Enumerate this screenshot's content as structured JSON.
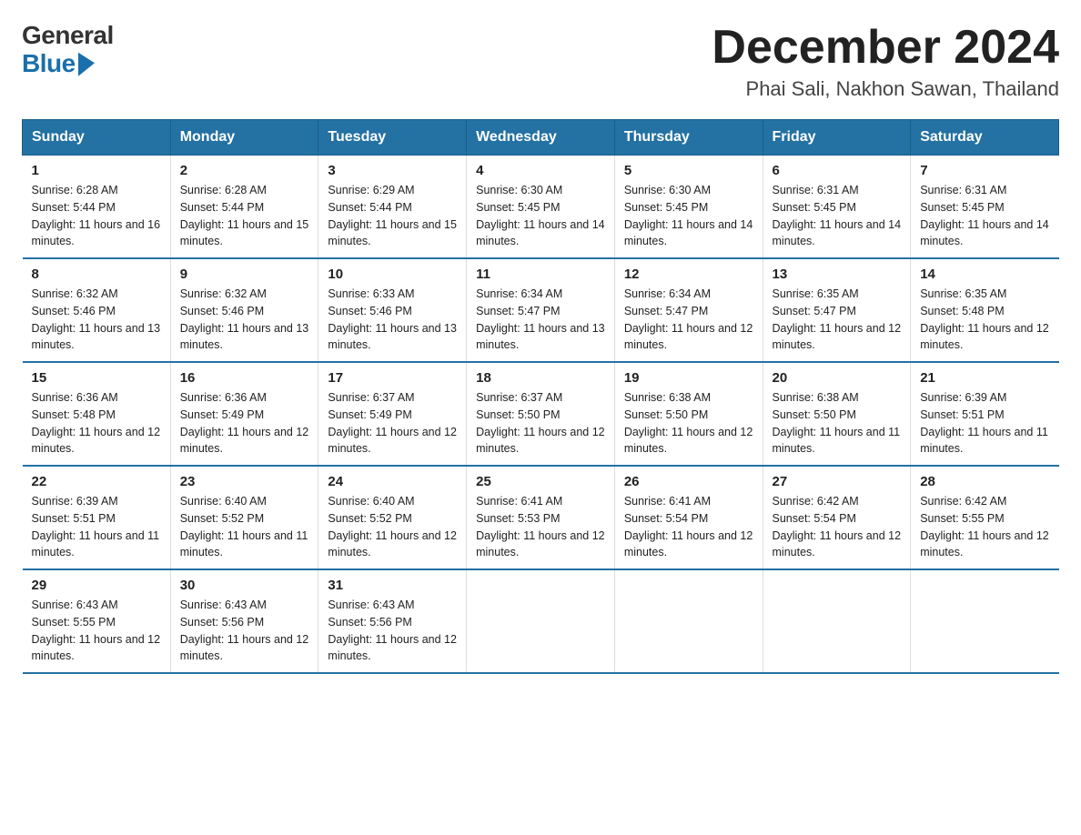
{
  "header": {
    "logo_general": "General",
    "logo_blue": "Blue",
    "month_title": "December 2024",
    "location": "Phai Sali, Nakhon Sawan, Thailand"
  },
  "weekdays": [
    "Sunday",
    "Monday",
    "Tuesday",
    "Wednesday",
    "Thursday",
    "Friday",
    "Saturday"
  ],
  "weeks": [
    [
      {
        "day": "1",
        "sunrise": "6:28 AM",
        "sunset": "5:44 PM",
        "daylight": "11 hours and 16 minutes."
      },
      {
        "day": "2",
        "sunrise": "6:28 AM",
        "sunset": "5:44 PM",
        "daylight": "11 hours and 15 minutes."
      },
      {
        "day": "3",
        "sunrise": "6:29 AM",
        "sunset": "5:44 PM",
        "daylight": "11 hours and 15 minutes."
      },
      {
        "day": "4",
        "sunrise": "6:30 AM",
        "sunset": "5:45 PM",
        "daylight": "11 hours and 14 minutes."
      },
      {
        "day": "5",
        "sunrise": "6:30 AM",
        "sunset": "5:45 PM",
        "daylight": "11 hours and 14 minutes."
      },
      {
        "day": "6",
        "sunrise": "6:31 AM",
        "sunset": "5:45 PM",
        "daylight": "11 hours and 14 minutes."
      },
      {
        "day": "7",
        "sunrise": "6:31 AM",
        "sunset": "5:45 PM",
        "daylight": "11 hours and 14 minutes."
      }
    ],
    [
      {
        "day": "8",
        "sunrise": "6:32 AM",
        "sunset": "5:46 PM",
        "daylight": "11 hours and 13 minutes."
      },
      {
        "day": "9",
        "sunrise": "6:32 AM",
        "sunset": "5:46 PM",
        "daylight": "11 hours and 13 minutes."
      },
      {
        "day": "10",
        "sunrise": "6:33 AM",
        "sunset": "5:46 PM",
        "daylight": "11 hours and 13 minutes."
      },
      {
        "day": "11",
        "sunrise": "6:34 AM",
        "sunset": "5:47 PM",
        "daylight": "11 hours and 13 minutes."
      },
      {
        "day": "12",
        "sunrise": "6:34 AM",
        "sunset": "5:47 PM",
        "daylight": "11 hours and 12 minutes."
      },
      {
        "day": "13",
        "sunrise": "6:35 AM",
        "sunset": "5:47 PM",
        "daylight": "11 hours and 12 minutes."
      },
      {
        "day": "14",
        "sunrise": "6:35 AM",
        "sunset": "5:48 PM",
        "daylight": "11 hours and 12 minutes."
      }
    ],
    [
      {
        "day": "15",
        "sunrise": "6:36 AM",
        "sunset": "5:48 PM",
        "daylight": "11 hours and 12 minutes."
      },
      {
        "day": "16",
        "sunrise": "6:36 AM",
        "sunset": "5:49 PM",
        "daylight": "11 hours and 12 minutes."
      },
      {
        "day": "17",
        "sunrise": "6:37 AM",
        "sunset": "5:49 PM",
        "daylight": "11 hours and 12 minutes."
      },
      {
        "day": "18",
        "sunrise": "6:37 AM",
        "sunset": "5:50 PM",
        "daylight": "11 hours and 12 minutes."
      },
      {
        "day": "19",
        "sunrise": "6:38 AM",
        "sunset": "5:50 PM",
        "daylight": "11 hours and 12 minutes."
      },
      {
        "day": "20",
        "sunrise": "6:38 AM",
        "sunset": "5:50 PM",
        "daylight": "11 hours and 11 minutes."
      },
      {
        "day": "21",
        "sunrise": "6:39 AM",
        "sunset": "5:51 PM",
        "daylight": "11 hours and 11 minutes."
      }
    ],
    [
      {
        "day": "22",
        "sunrise": "6:39 AM",
        "sunset": "5:51 PM",
        "daylight": "11 hours and 11 minutes."
      },
      {
        "day": "23",
        "sunrise": "6:40 AM",
        "sunset": "5:52 PM",
        "daylight": "11 hours and 11 minutes."
      },
      {
        "day": "24",
        "sunrise": "6:40 AM",
        "sunset": "5:52 PM",
        "daylight": "11 hours and 12 minutes."
      },
      {
        "day": "25",
        "sunrise": "6:41 AM",
        "sunset": "5:53 PM",
        "daylight": "11 hours and 12 minutes."
      },
      {
        "day": "26",
        "sunrise": "6:41 AM",
        "sunset": "5:54 PM",
        "daylight": "11 hours and 12 minutes."
      },
      {
        "day": "27",
        "sunrise": "6:42 AM",
        "sunset": "5:54 PM",
        "daylight": "11 hours and 12 minutes."
      },
      {
        "day": "28",
        "sunrise": "6:42 AM",
        "sunset": "5:55 PM",
        "daylight": "11 hours and 12 minutes."
      }
    ],
    [
      {
        "day": "29",
        "sunrise": "6:43 AM",
        "sunset": "5:55 PM",
        "daylight": "11 hours and 12 minutes."
      },
      {
        "day": "30",
        "sunrise": "6:43 AM",
        "sunset": "5:56 PM",
        "daylight": "11 hours and 12 minutes."
      },
      {
        "day": "31",
        "sunrise": "6:43 AM",
        "sunset": "5:56 PM",
        "daylight": "11 hours and 12 minutes."
      },
      null,
      null,
      null,
      null
    ]
  ]
}
